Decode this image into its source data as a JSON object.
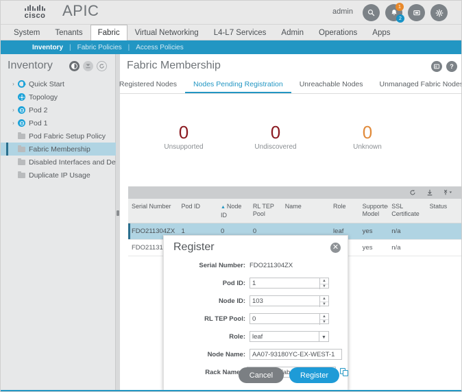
{
  "header": {
    "logo_text": "cisco",
    "app_title": "APIC",
    "user": "admin",
    "icons": [
      {
        "name": "search-icon",
        "glyph": "search"
      },
      {
        "name": "alert-bell-icon",
        "glyph": "bell",
        "badge_top": "1",
        "badge_bottom": "2"
      },
      {
        "name": "tasks-icon",
        "glyph": "screen"
      },
      {
        "name": "settings-gear-icon",
        "glyph": "gear"
      }
    ]
  },
  "nav": {
    "items": [
      {
        "label": "System",
        "active": false
      },
      {
        "label": "Tenants",
        "active": false
      },
      {
        "label": "Fabric",
        "active": true
      },
      {
        "label": "Virtual Networking",
        "active": false
      },
      {
        "label": "L4-L7 Services",
        "active": false
      },
      {
        "label": "Admin",
        "active": false
      },
      {
        "label": "Operations",
        "active": false
      },
      {
        "label": "Apps",
        "active": false
      }
    ]
  },
  "subnav": {
    "items": [
      {
        "label": "Inventory",
        "active": true
      },
      {
        "label": "Fabric Policies",
        "active": false
      },
      {
        "label": "Access Policies",
        "active": false
      }
    ],
    "separator": "|"
  },
  "sidebar": {
    "title": "Inventory",
    "header_icons": [
      {
        "name": "half-circle-toggle-icon"
      },
      {
        "name": "collapse-panel-icon"
      },
      {
        "name": "refresh-icon"
      }
    ],
    "items": [
      {
        "label": "Quick Start",
        "icon": "quickstart-icon",
        "caret": "›",
        "selected": false
      },
      {
        "label": "Topology",
        "icon": "topology-icon",
        "caret": "",
        "selected": false
      },
      {
        "label": "Pod 2",
        "icon": "pod-icon",
        "caret": "›",
        "selected": false
      },
      {
        "label": "Pod 1",
        "icon": "pod-icon",
        "caret": "›",
        "selected": false
      },
      {
        "label": "Pod Fabric Setup Policy",
        "icon": "folder-icon",
        "caret": "",
        "selected": false
      },
      {
        "label": "Fabric Membership",
        "icon": "folder-icon",
        "caret": "",
        "selected": true
      },
      {
        "label": "Disabled Interfaces and Decommi",
        "icon": "folder-icon",
        "caret": "",
        "selected": false
      },
      {
        "label": "Duplicate IP Usage",
        "icon": "folder-icon",
        "caret": "",
        "selected": false
      }
    ]
  },
  "content": {
    "page_title": "Fabric Membership",
    "header_icons": [
      {
        "name": "table-view-icon"
      },
      {
        "name": "help-icon",
        "glyph": "?"
      }
    ],
    "tabs": [
      {
        "label": "Registered Nodes",
        "active": false
      },
      {
        "label": "Nodes Pending Registration",
        "active": true
      },
      {
        "label": "Unreachable Nodes",
        "active": false
      },
      {
        "label": "Unmanaged Fabric Nodes",
        "active": false
      }
    ],
    "kpis": [
      {
        "value": "0",
        "label": "Unsupported",
        "color": "red"
      },
      {
        "value": "0",
        "label": "Undiscovered",
        "color": "red"
      },
      {
        "value": "0",
        "label": "Unknown",
        "color": "orange"
      }
    ],
    "table_toolbar": [
      {
        "name": "refresh-icon"
      },
      {
        "name": "download-icon"
      },
      {
        "name": "actions-menu-icon"
      }
    ],
    "table": {
      "columns": [
        {
          "label": "Serial Number",
          "sorted": false
        },
        {
          "label": "Pod ID",
          "sorted": false
        },
        {
          "label": "Node ID",
          "sorted": true
        },
        {
          "label": "RL TEP Pool",
          "sorted": false
        },
        {
          "label": "Name",
          "sorted": false
        },
        {
          "label": "Role",
          "sorted": false
        },
        {
          "label": "Supported Model",
          "sorted": false
        },
        {
          "label": "SSL Certificate",
          "sorted": false
        },
        {
          "label": "Status",
          "sorted": false
        }
      ],
      "rows": [
        {
          "selected": true,
          "cells": [
            "FDO211304ZX",
            "1",
            "0",
            "0",
            "",
            "leaf",
            "yes",
            "n/a",
            ""
          ]
        },
        {
          "selected": false,
          "cells": [
            "FDO21131",
            "",
            "",
            "",
            "",
            "",
            "yes",
            "n/a",
            ""
          ]
        }
      ]
    }
  },
  "dialog": {
    "title": "Register",
    "close_label": "✕",
    "serial_label": "Serial Number:",
    "serial_value": "FDO211304ZX",
    "fields": [
      {
        "label": "Pod ID:",
        "value": "1",
        "type": "spinner"
      },
      {
        "label": "Node ID:",
        "value": "103",
        "type": "spinner"
      },
      {
        "label": "RL TEP Pool:",
        "value": "0",
        "type": "spinner"
      },
      {
        "label": "Role:",
        "value": "leaf",
        "type": "select"
      },
      {
        "label": "Node Name:",
        "value": "AA07-93180YC-EX-WEST-1",
        "type": "text"
      },
      {
        "label": "Rack Name:",
        "value": "AA07 (site:fabric, building:default, fl",
        "type": "select-copy"
      }
    ],
    "cancel_label": "Cancel",
    "submit_label": "Register"
  },
  "colors": {
    "accent_blue": "#2296c3",
    "selection_blue": "#b0d4e3",
    "kpi_red": "#8b1a21",
    "kpi_orange": "#e18b3c",
    "primary_button": "#1e9bd7"
  }
}
